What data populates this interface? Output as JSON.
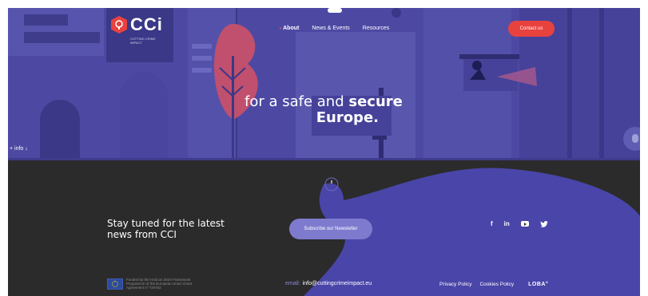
{
  "brand": {
    "logo_text": "CCi",
    "logo_sub": "CUTTING CRIME IMPACT"
  },
  "nav": {
    "items": [
      {
        "label": "About",
        "active": true
      },
      {
        "label": "News & Events",
        "active": false
      },
      {
        "label": "Resources",
        "active": false
      }
    ],
    "contact_label": "Contact us"
  },
  "hero": {
    "tagline_pre": "for a safe and ",
    "tagline_bold": "secure",
    "tagline_line2": "Europe.",
    "more_info": "+ info ↓"
  },
  "footer": {
    "stay_tuned": "Stay tuned for the latest news from CCI",
    "subscribe_label": "Subscribe our Newsletter",
    "social": {
      "facebook": "f",
      "linkedin": "in",
      "youtube": "youtube-icon",
      "twitter": "twitter-icon"
    },
    "eu_text": "Funded by the Horizon 2020 Framework Programme of the European Union Grant Agreement nº 720762",
    "email_label": "email:",
    "email_value": "info@cuttingcrimeimpact.eu",
    "privacy": "Privacy Policy",
    "cookies": "Cookies Policy",
    "loba": "LOBA°"
  },
  "colors": {
    "hero_bg": "#4d49a3",
    "footer_bg": "#2b2b2b",
    "accent_red": "#e8423f",
    "lilac": "#7e7bcf"
  }
}
